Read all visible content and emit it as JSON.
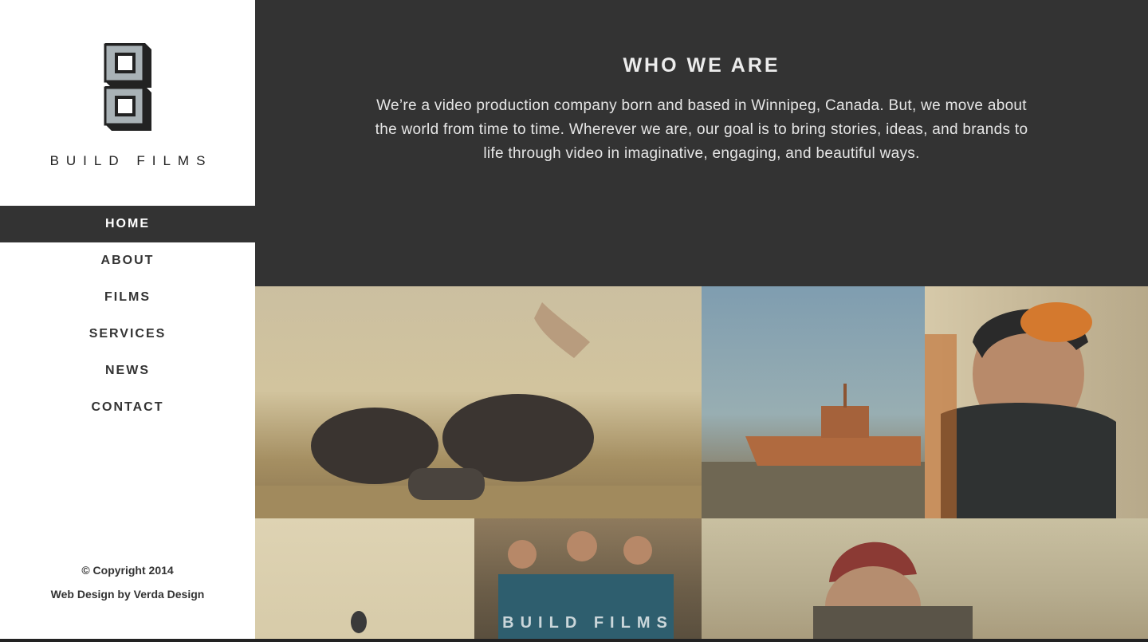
{
  "brand": {
    "name": "BUILD FILMS"
  },
  "nav": {
    "items": [
      {
        "label": "HOME",
        "active": true
      },
      {
        "label": "ABOUT",
        "active": false
      },
      {
        "label": "FILMS",
        "active": false
      },
      {
        "label": "SERVICES",
        "active": false
      },
      {
        "label": "NEWS",
        "active": false
      },
      {
        "label": "CONTACT",
        "active": false
      }
    ]
  },
  "footer": {
    "copyright": "© Copyright 2014",
    "credit": "Web Design by Verda Design"
  },
  "hero": {
    "title": "WHO WE ARE",
    "text": "We’re a video production company born and based in Winnipeg, Canada. But, we move about the world from time to time. Wherever we are, our goal is to bring stories, ideas, and brands to life through video in imaginative, engaging, and beautiful ways."
  },
  "gallery": {
    "caption": "BUILD FILMS"
  },
  "colors": {
    "dark": "#333333",
    "white": "#ffffff"
  }
}
